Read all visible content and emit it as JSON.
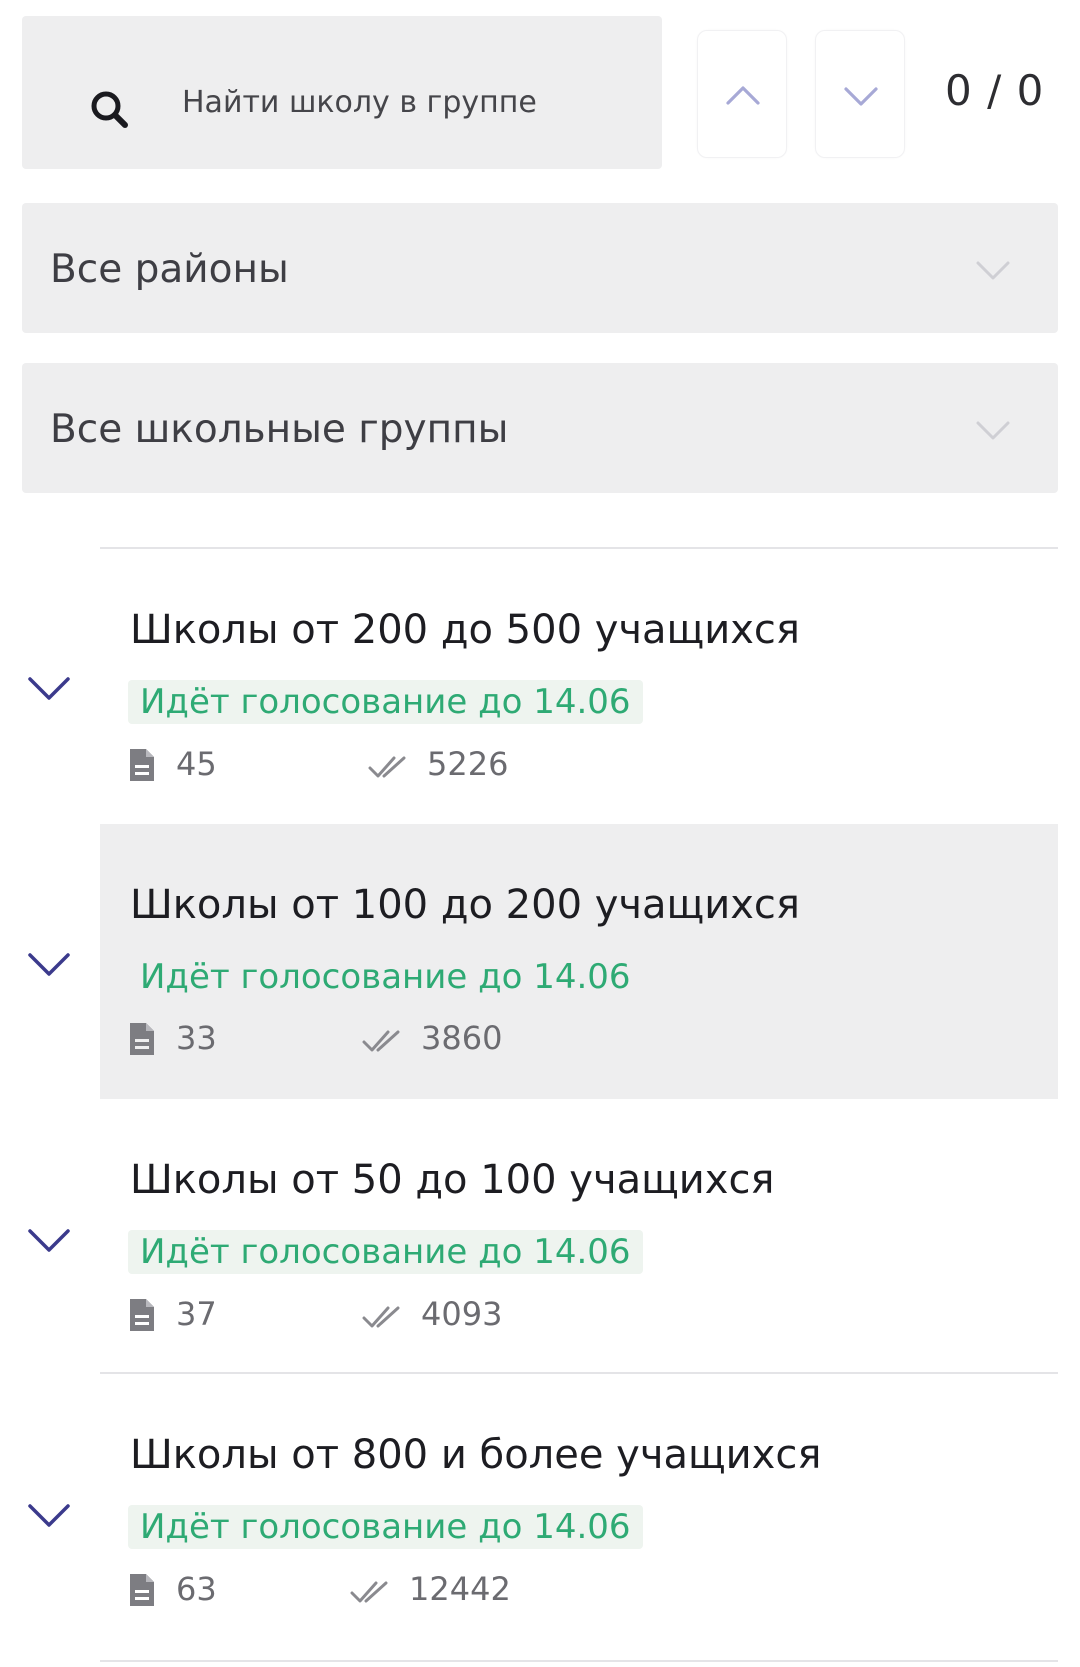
{
  "search": {
    "placeholder": "Найти школу в группе",
    "value": "",
    "counter": "0 / 0"
  },
  "filters": {
    "district": {
      "selected": "Все районы"
    },
    "school_group": {
      "selected": "Все школьные группы"
    }
  },
  "groups": [
    {
      "title": "Школы от 200 до 500 учащихся",
      "status": "Идёт голосование до 14.06",
      "schools_count": "45",
      "votes_count": "5226"
    },
    {
      "title": "Школы от 100 до 200 учащихся",
      "status": "Идёт голосование до 14.06",
      "schools_count": "33",
      "votes_count": "3860"
    },
    {
      "title": "Школы от 50 до 100 учащихся",
      "status": "Идёт голосование до 14.06",
      "schools_count": "37",
      "votes_count": "4093"
    },
    {
      "title": "Школы от 800 и более учащихся",
      "status": "Идёт голосование до 14.06",
      "schools_count": "63",
      "votes_count": "12442"
    }
  ],
  "colors": {
    "accent_chevron": "#3b3a8c",
    "status_green": "#2eaa74",
    "panel_gray": "#eeeeef"
  },
  "icons": {
    "search": "search-icon",
    "prev": "chevron-up-icon",
    "next": "chevron-down-icon",
    "expand": "chevron-down-icon",
    "schools": "document-icon",
    "votes": "double-check-icon"
  }
}
